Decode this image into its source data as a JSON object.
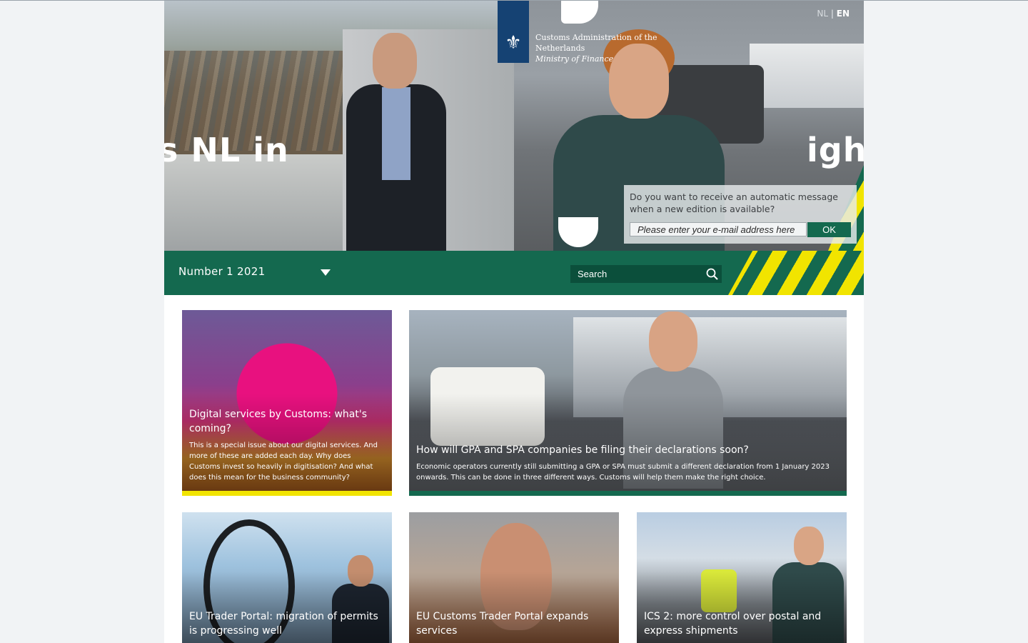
{
  "site": {
    "logo_line1": "Customs Administration of the",
    "logo_line2": "Netherlands",
    "logo_ministry": "Ministry of Finance",
    "lang_nl": "NL",
    "lang_sep": "|",
    "lang_en": "EN",
    "hero_word_left": "s NL in",
    "hero_word_right": "ight"
  },
  "subscribe": {
    "question": "Do you want to receive an automatic message when a new edition is available?",
    "email_placeholder": "Please enter your e-mail address here",
    "ok_label": "OK"
  },
  "nav": {
    "edition_label": "Number 1 2021",
    "search_placeholder": "Search"
  },
  "colors": {
    "brand_green": "#14694f",
    "accent_yellow": "#f1e400",
    "rijks_blue": "#154273"
  },
  "articles": [
    {
      "title": "Digital services by Customs: what's coming?",
      "description": "This is a special issue about our digital services. And more of these are added each day. Why does Customs invest so heavily in digitisation? And what does this mean for the business community?",
      "bar_color": "#f1e400"
    },
    {
      "title": "How will GPA and SPA companies be filing their declarations soon?",
      "description": "Economic operators currently still submitting a GPA or SPA must submit a different declaration from 1 January 2023 onwards. This can be done in three different ways. Customs will help them make the right choice.",
      "bar_color": "#14694f"
    },
    {
      "title": "EU Trader Portal: migration of permits is progressing well"
    },
    {
      "title": "EU Customs Trader Portal expands services"
    },
    {
      "title": "ICS 2: more control over postal and express shipments"
    }
  ]
}
